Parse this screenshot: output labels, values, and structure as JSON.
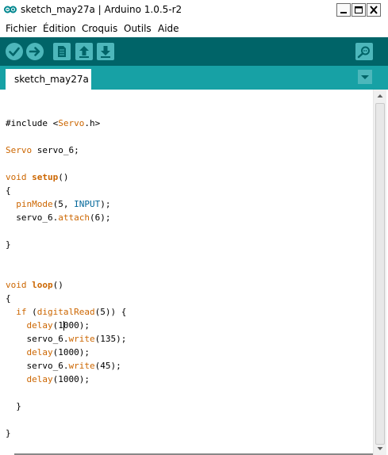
{
  "window": {
    "title": "sketch_may27a | Arduino 1.0.5-r2"
  },
  "menu": {
    "items": [
      "Fichier",
      "Édition",
      "Croquis",
      "Outils",
      "Aide"
    ]
  },
  "toolbar": {
    "buttons": [
      "verify-icon",
      "upload-icon",
      "new-icon",
      "open-icon",
      "save-icon",
      "serial-monitor-icon"
    ],
    "bg_color": "#006468"
  },
  "tabs": {
    "active": "sketch_may27a",
    "bar_color": "#17a1a5"
  },
  "code": {
    "lines": [
      "#include <Servo.h>",
      "",
      "Servo servo_6;",
      "",
      "void setup()",
      "{",
      "  pinMode(5, INPUT);",
      "  servo_6.attach(6);",
      "",
      "}",
      "",
      "",
      "void loop()",
      "{",
      "  if (digitalRead(5)) {",
      "    delay(1000);",
      "    servo_6.write(135);",
      "    delay(1000);",
      "    servo_6.write(45);",
      "    delay(1000);",
      "",
      "  }",
      "",
      "}"
    ],
    "colors": {
      "keyword": "#cc6600",
      "constant": "#006699"
    }
  }
}
